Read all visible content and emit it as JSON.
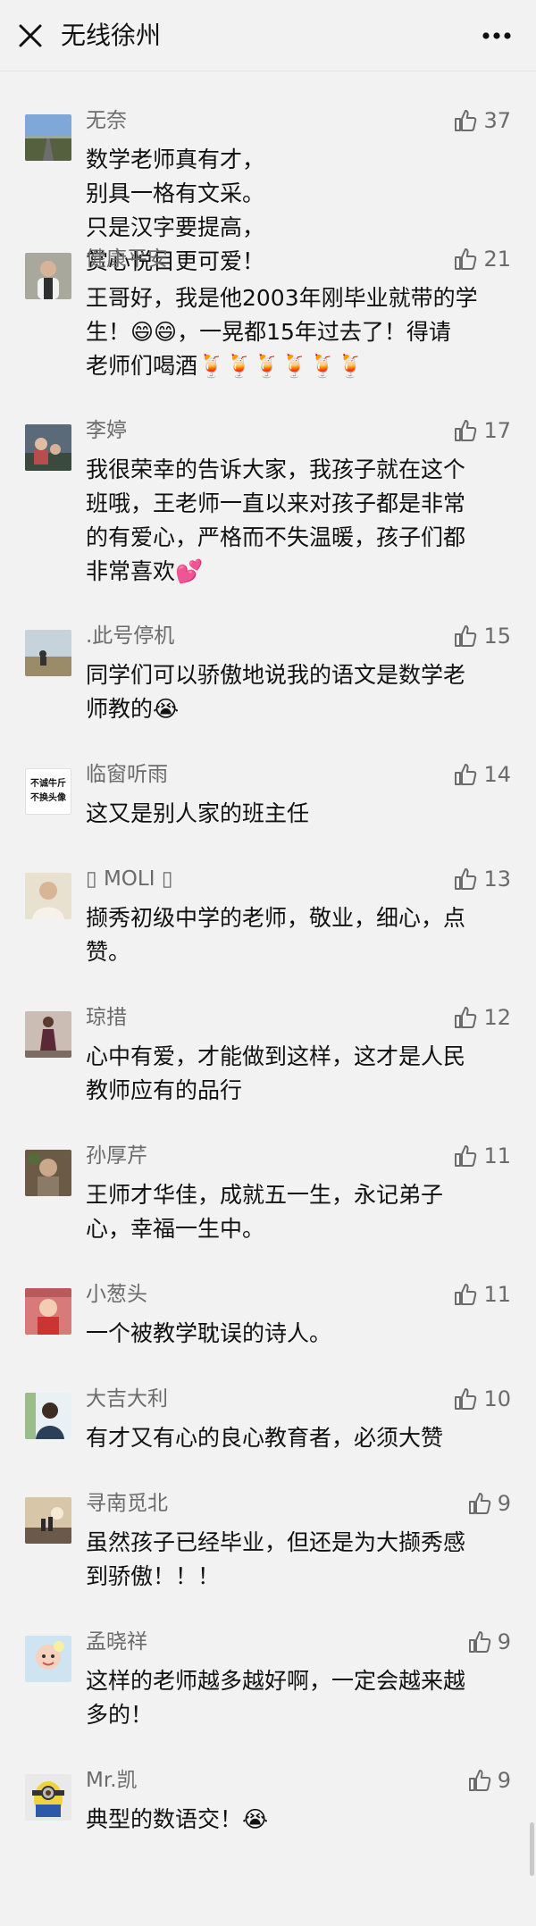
{
  "header": {
    "title": "无线徐州",
    "close_icon": "close-icon",
    "more_icon": "more-icon"
  },
  "comments": [
    {
      "name": "无奈",
      "likes": "37",
      "lines": [
        "数学老师真有才，",
        "别具一格有文采。",
        "只是汉字要提高，",
        "赏心悦目更可爱！"
      ]
    },
    {
      "name": "健康平安",
      "likes": "21",
      "lines": [
        "王哥好，我是他2003年刚毕业就带的学",
        "生！😄😄，一晃都15年过去了！得请",
        "老师们喝酒🍹🍹🍹🍹🍹🍹"
      ]
    },
    {
      "name": "李婷",
      "likes": "17",
      "lines": [
        "我很荣幸的告诉大家，我孩子就在这个",
        "班哦，王老师一直以来对孩子都是非常",
        "的有爱心，严格而不失温暖，孩子们都",
        "非常喜欢💕"
      ]
    },
    {
      "name": ".此号停机",
      "likes": "15",
      "lines": [
        "同学们可以骄傲地说我的语文是数学老",
        "师教的😭"
      ]
    },
    {
      "name": "临窗听雨",
      "likes": "14",
      "lines": [
        "这又是别人家的班主任"
      ]
    },
    {
      "name": "▯ MOLI ▯",
      "likes": "13",
      "lines": [
        "撷秀初级中学的老师，敬业，细心，点",
        "赞。"
      ]
    },
    {
      "name": "琼措",
      "likes": "12",
      "lines": [
        "心中有爱，才能做到这样，这才是人民",
        "教师应有的品行"
      ]
    },
    {
      "name": "孙厚芹",
      "likes": "11",
      "lines": [
        "王师才华佳，成就五一生，永记弟子",
        "心，幸福一生中。"
      ]
    },
    {
      "name": "小葱头",
      "likes": "11",
      "lines": [
        "一个被教学耽误的诗人。"
      ]
    },
    {
      "name": "大吉大利",
      "likes": "10",
      "lines": [
        "有才又有心的良心教育者，必须大赞"
      ]
    },
    {
      "name": "寻南觅北",
      "likes": "9",
      "lines": [
        "虽然孩子已经毕业，但还是为大撷秀感",
        "到骄傲！！！"
      ]
    },
    {
      "name": "孟晓祥",
      "likes": "9",
      "lines": [
        "这样的老师越多越好啊，一定会越来越",
        "多的！"
      ]
    },
    {
      "name": "Mr.凯",
      "likes": "9",
      "lines": [
        "典型的数语交！😭"
      ]
    }
  ],
  "avatar_texts": {
    "linchuang": [
      "不诚牛斤",
      "不换头像"
    ]
  },
  "icons": {
    "like": "thumbs-up-icon"
  },
  "colors": {
    "background": "#f2f2f2",
    "secondary_text": "#6b6b6b",
    "primary_text": "#111111"
  }
}
